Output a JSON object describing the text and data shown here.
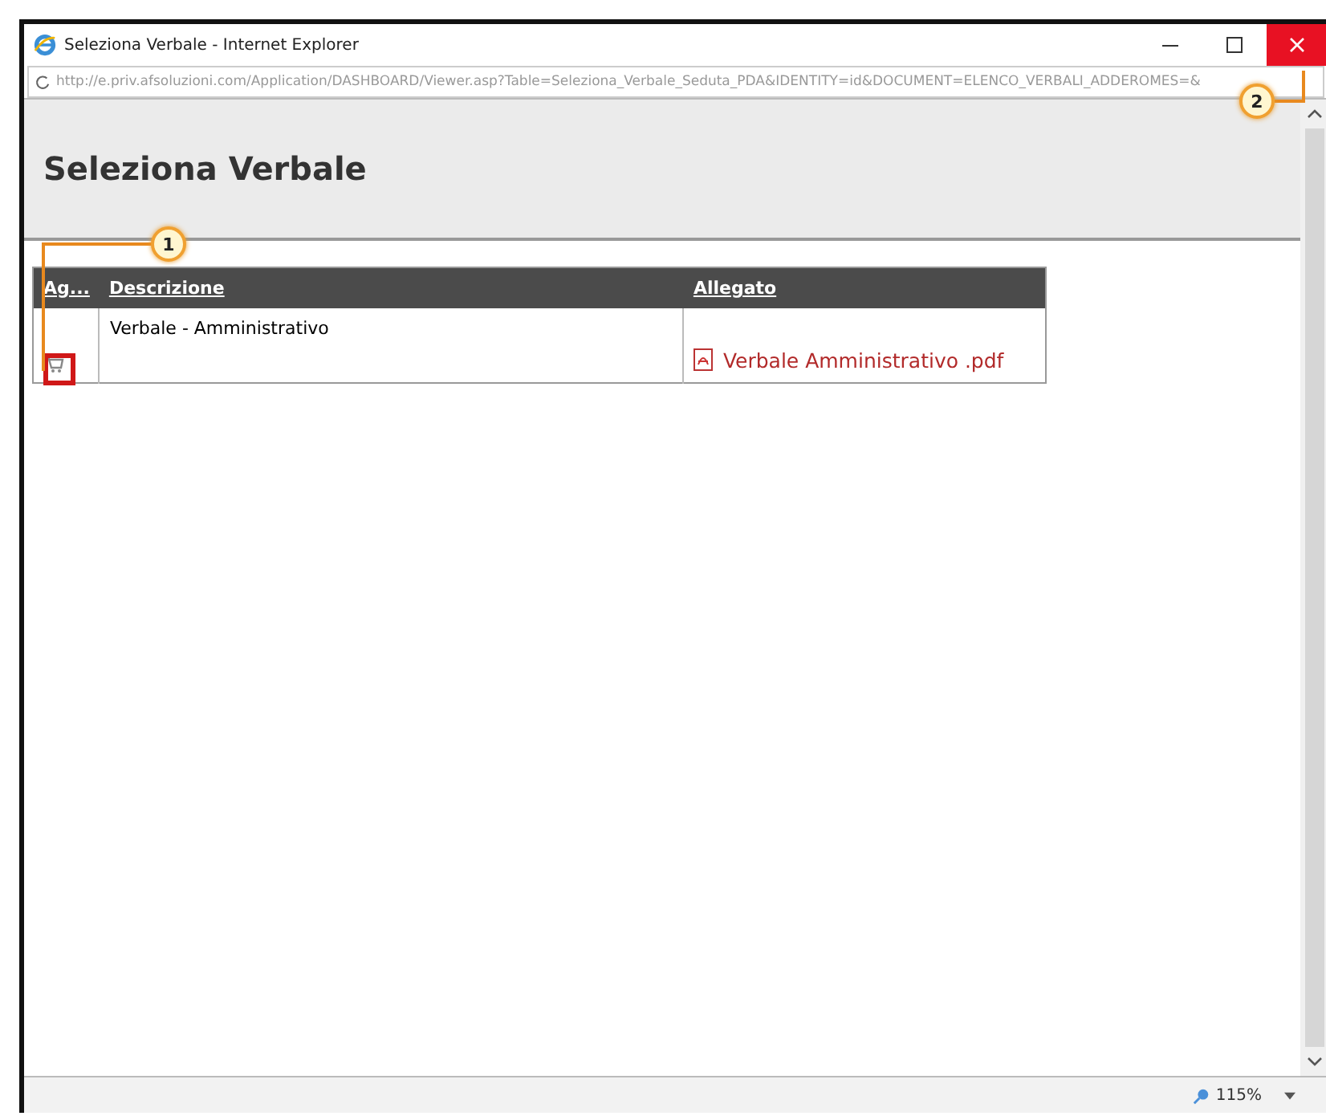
{
  "window": {
    "title": "Seleziona Verbale - Internet Explorer",
    "address": "http://e.priv.afsoluzioni.com/Application/DASHBOARD/Viewer.asp?Table=Seleziona_Verbale_Seduta_PDA&IDENTITY=id&DOCUMENT=ELENCO_VERBALI_ADDEROMES=&"
  },
  "page": {
    "heading": "Seleziona Verbale"
  },
  "table": {
    "columns": [
      "Ag...",
      "Descrizione",
      "Allegato"
    ],
    "rows": [
      {
        "description": "Verbale - Amministrativo",
        "attachment": "Verbale Amministrativo .pdf"
      }
    ]
  },
  "callouts": [
    {
      "number": "1",
      "kind": "icon"
    },
    {
      "number": "2",
      "kind": "close"
    }
  ],
  "status_bar": {
    "zoom": "115%"
  }
}
